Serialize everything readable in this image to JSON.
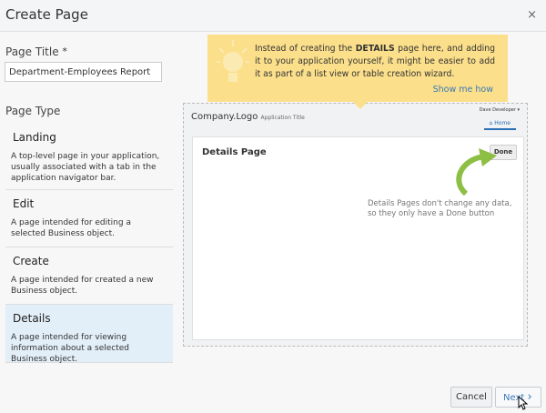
{
  "header": {
    "title": "Create Page",
    "close": "×"
  },
  "page_title": {
    "label": "Page Title",
    "required": "*",
    "value": "Department-Employees Report"
  },
  "page_type": {
    "label": "Page Type",
    "items": [
      {
        "name": "Landing",
        "desc": "A top-level page in your application, usually associated with a tab in the application navigator bar."
      },
      {
        "name": "Edit",
        "desc": "A page intended for editing a selected Business object."
      },
      {
        "name": "Create",
        "desc": "A page intended for created a new Business object."
      },
      {
        "name": "Details",
        "desc": "A page intended for viewing information about a selected Business object."
      }
    ]
  },
  "tip": {
    "pre": "Instead of creating the ",
    "bold": "DETAILS",
    "post": " page here, and adding it to your application yourself, it might be easier to add it as part of a list view or table creation wizard.",
    "link": "Show me how"
  },
  "preview": {
    "logo": "Company.Logo",
    "app_title": "Application Title",
    "user": "Dave Developer ▾",
    "home": "Home",
    "card_title": "Details Page",
    "done": "Done",
    "note": "Details Pages don't change any data, so they only have a Done button"
  },
  "footer": {
    "cancel": "Cancel",
    "next": "Next"
  }
}
